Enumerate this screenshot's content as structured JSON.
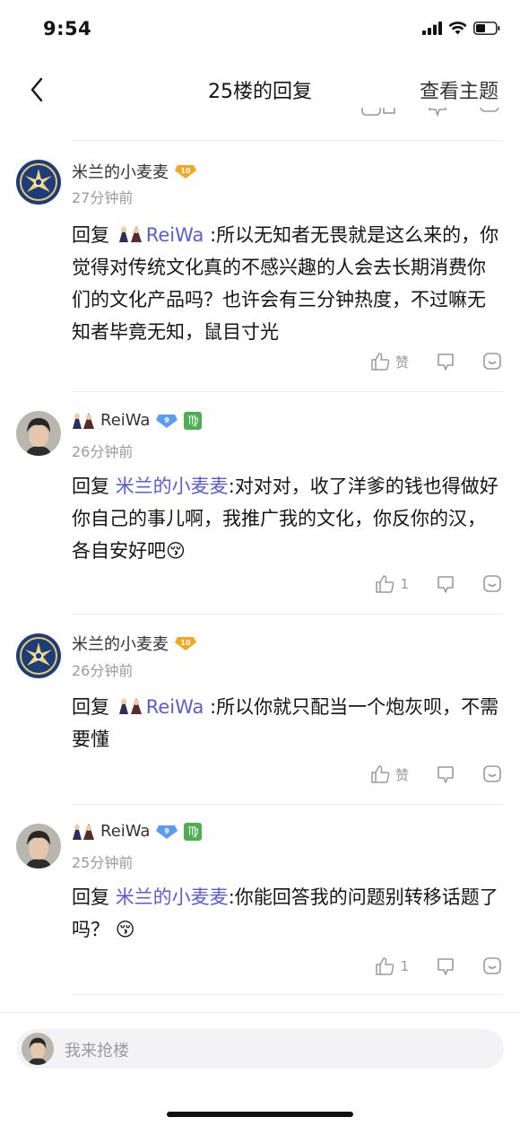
{
  "status_bar": {
    "time": "9:54"
  },
  "nav": {
    "title": "25楼的回复",
    "right_label": "查看主题"
  },
  "input": {
    "placeholder": "我来抢楼"
  },
  "replies": [
    {
      "username": "米兰的小麦麦",
      "level": "10",
      "time": "27分钟前",
      "reply_word": "回复",
      "mention": "ReiWa",
      "text": ":所以无知者无畏就是这么来的，你觉得对传统文化真的不感兴趣的人会去长期消费你们的文化产品吗？也许会有三分钟热度，不过嘛无知者毕竟无知，鼠目寸光",
      "like_label": "赞"
    },
    {
      "username": "ReiWa",
      "level": "9",
      "zodiac": "♍",
      "time": "26分钟前",
      "reply_word": "回复",
      "mention": "米兰的小麦麦",
      "text": ":对对对，收了洋爹的钱也得做好你自己的事儿啊，我推广我的文化，你反你的汉，各自安好吧",
      "emoji": "😚",
      "like_label": "1"
    },
    {
      "username": "米兰的小麦麦",
      "level": "10",
      "time": "26分钟前",
      "reply_word": "回复",
      "mention": "ReiWa",
      "text": ":所以你就只配当一个炮灰呗，不需要懂",
      "like_label": "赞"
    },
    {
      "username": "ReiWa",
      "level": "9",
      "zodiac": "♍",
      "time": "25分钟前",
      "reply_word": "回复",
      "mention": "米兰的小麦麦",
      "text": ":你能回答我的问题别转移话题了吗？",
      "emoji": "😚",
      "like_label": "1"
    }
  ],
  "colors": {
    "mention": "#5a5bd8",
    "level_orange": "#f5a623",
    "level_blue": "#5b9cf2",
    "zodiac_green": "#4caf50",
    "meta_gray": "#9a9a9a"
  }
}
